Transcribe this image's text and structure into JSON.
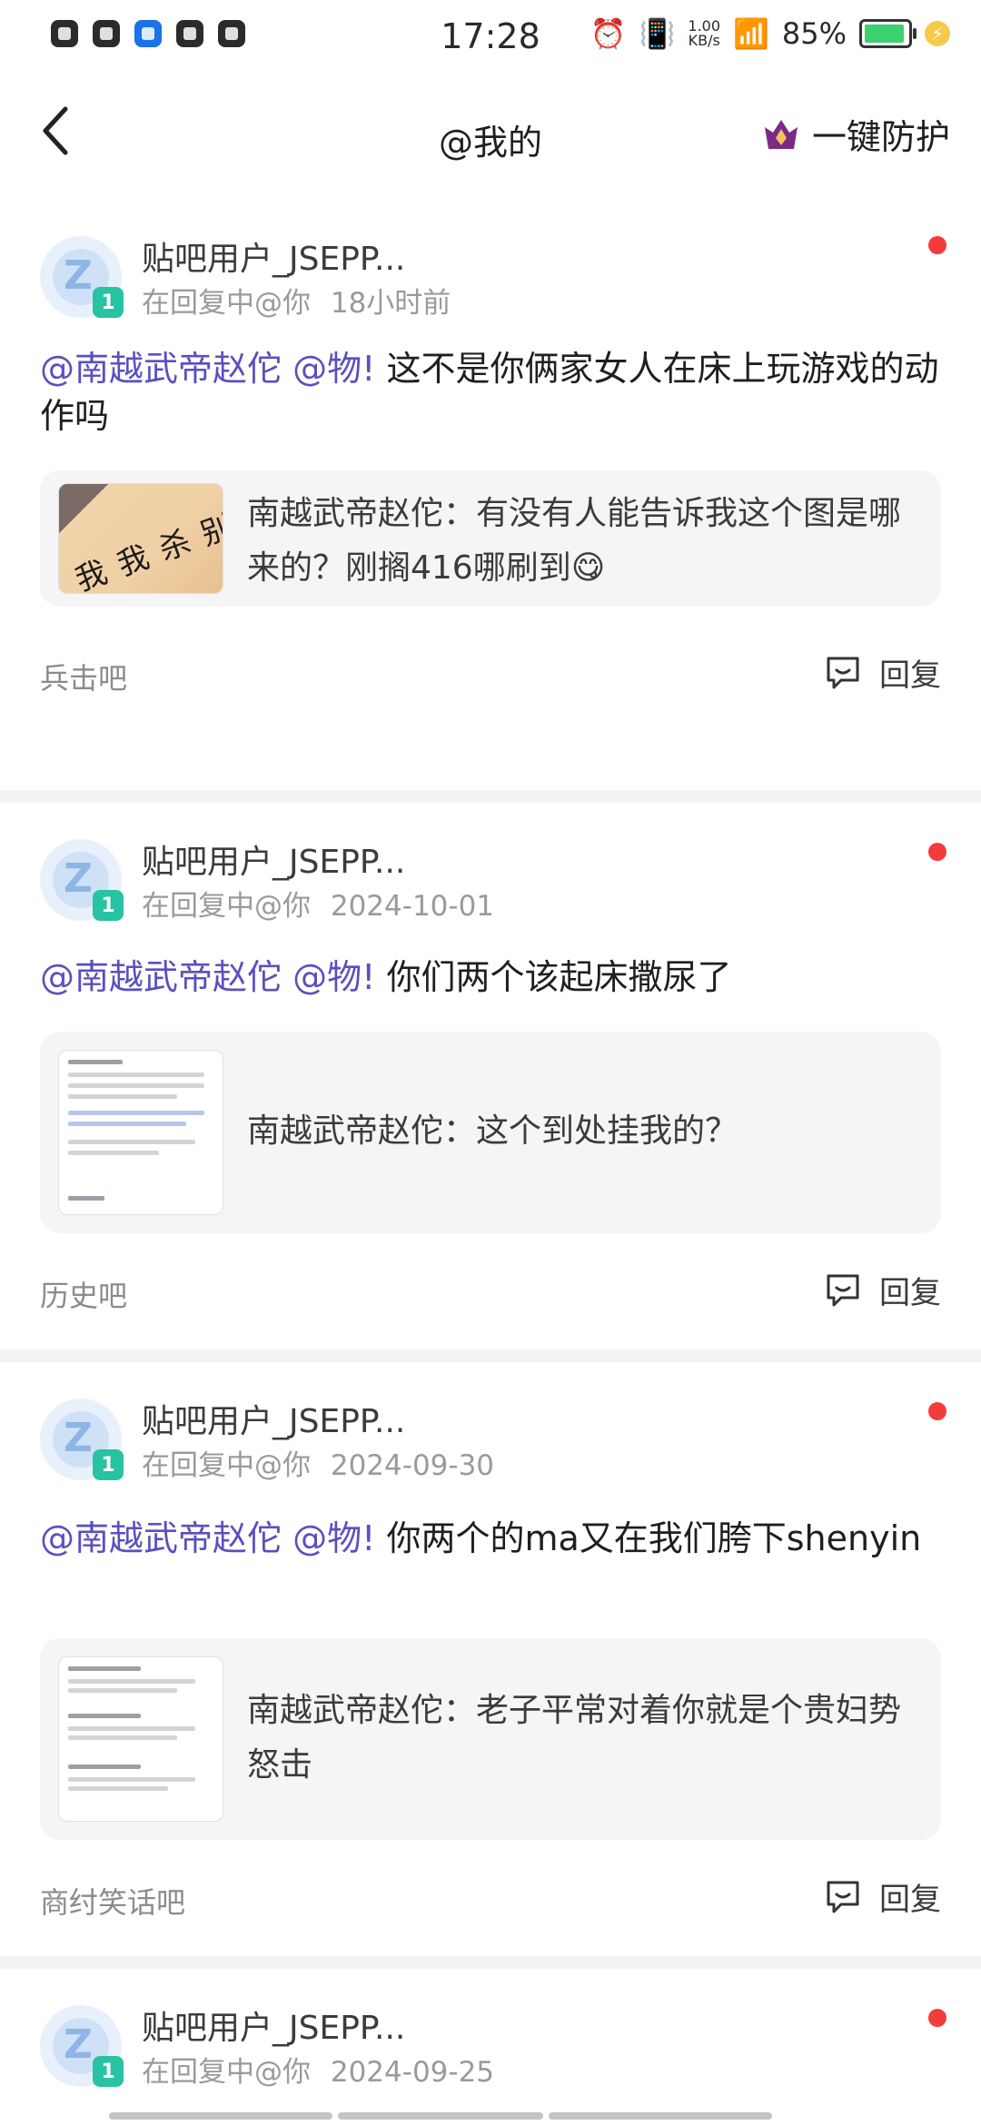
{
  "status_bar": {
    "time": "17:28",
    "net_speed_value": "1.00",
    "net_speed_unit": "KB/s",
    "battery": "85%",
    "left_icons": [
      "sim-icon",
      "app-icon",
      "nav-icon",
      "play-icon",
      "sound-icon"
    ]
  },
  "header": {
    "title": "@我的",
    "protect_label": "一键防护",
    "back_icon": "back-arrow-icon",
    "protect_icon": "crown-shield-icon"
  },
  "items": [
    {
      "username": "贴吧用户_JSEPP...",
      "level": "1",
      "meta_prefix": "在回复中@你",
      "time": "18小时前",
      "mention1": "@南越武帝赵佗",
      "mention2": "@物!",
      "text": "这不是你俩家女人在床上玩游戏的动作吗",
      "quote": "南越武帝赵佗：有没有人能告诉我这个图是哪来的？刚搁416哪刷到😋",
      "thumb_text": "别杀我我",
      "forum": "兵击吧",
      "reply": "回复"
    },
    {
      "username": "贴吧用户_JSEPP...",
      "level": "1",
      "meta_prefix": "在回复中@你",
      "time": "2024-10-01",
      "mention1": "@南越武帝赵佗",
      "mention2": "@物!",
      "text": "你们两个该起床撒尿了",
      "quote": "南越武帝赵佗：这个到处挂我的？",
      "forum": "历史吧",
      "reply": "回复"
    },
    {
      "username": "贴吧用户_JSEPP...",
      "level": "1",
      "meta_prefix": "在回复中@你",
      "time": "2024-09-30",
      "mention1": "@南越武帝赵佗",
      "mention2": "@物!",
      "text": "你两个的ma又在我们胯下shenyin",
      "quote": "南越武帝赵佗：老子平常对着你就是个贵妇势怒击",
      "forum": "商纣笑话吧",
      "reply": "回复"
    },
    {
      "username": "贴吧用户_JSEPP...",
      "level": "1",
      "meta_prefix": "在回复中@你",
      "time": "2024-09-25"
    }
  ]
}
